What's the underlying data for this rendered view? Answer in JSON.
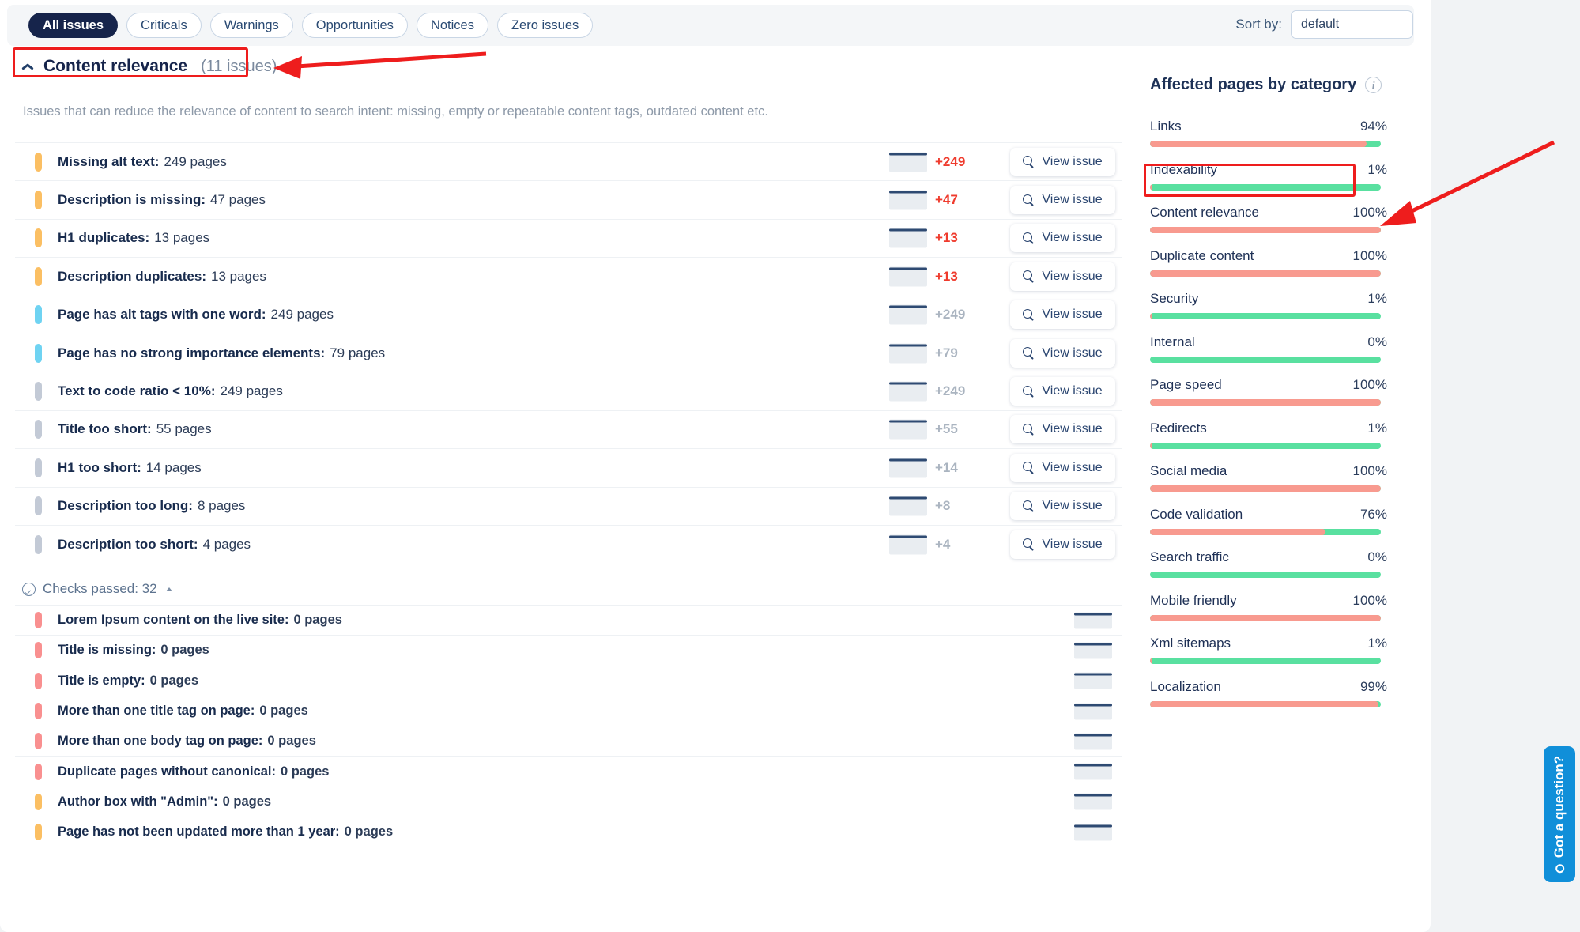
{
  "filters": {
    "items": [
      {
        "label": "All issues",
        "active": true
      },
      {
        "label": "Criticals",
        "active": false
      },
      {
        "label": "Warnings",
        "active": false
      },
      {
        "label": "Opportunities",
        "active": false
      },
      {
        "label": "Notices",
        "active": false
      },
      {
        "label": "Zero issues",
        "active": false
      }
    ]
  },
  "sort": {
    "label": "Sort by:",
    "value": "default",
    "options": [
      "default"
    ]
  },
  "section": {
    "title": "Content relevance",
    "count": "(11 issues)",
    "description": "Issues that can reduce the relevance of content to search intent: missing, empty or repeatable content tags, outdated content etc."
  },
  "issues": [
    {
      "label": "Missing alt text:",
      "count": "249 pages",
      "severity": "warning",
      "delta": "+249",
      "delta_tone": "red",
      "action": "View issue"
    },
    {
      "label": "Description is missing:",
      "count": "47 pages",
      "severity": "warning",
      "delta": "+47",
      "delta_tone": "red",
      "action": "View issue"
    },
    {
      "label": "H1 duplicates:",
      "count": "13 pages",
      "severity": "warning",
      "delta": "+13",
      "delta_tone": "red",
      "action": "View issue"
    },
    {
      "label": "Description duplicates:",
      "count": "13 pages",
      "severity": "warning",
      "delta": "+13",
      "delta_tone": "red",
      "action": "View issue"
    },
    {
      "label": "Page has alt tags with one word:",
      "count": "249 pages",
      "severity": "opportunity",
      "delta": "+249",
      "delta_tone": "gray",
      "action": "View issue"
    },
    {
      "label": "Page has no strong importance elements:",
      "count": "79 pages",
      "severity": "opportunity",
      "delta": "+79",
      "delta_tone": "gray",
      "action": "View issue"
    },
    {
      "label": "Text to code ratio < 10%:",
      "count": "249 pages",
      "severity": "notice",
      "delta": "+249",
      "delta_tone": "gray",
      "action": "View issue"
    },
    {
      "label": "Title too short:",
      "count": "55 pages",
      "severity": "notice",
      "delta": "+55",
      "delta_tone": "gray",
      "action": "View issue"
    },
    {
      "label": "H1 too short:",
      "count": "14 pages",
      "severity": "notice",
      "delta": "+14",
      "delta_tone": "gray",
      "action": "View issue"
    },
    {
      "label": "Description too long:",
      "count": "8 pages",
      "severity": "notice",
      "delta": "+8",
      "delta_tone": "gray",
      "action": "View issue"
    },
    {
      "label": "Description too short:",
      "count": "4 pages",
      "severity": "notice",
      "delta": "+4",
      "delta_tone": "gray",
      "action": "View issue"
    }
  ],
  "checks_passed": {
    "label": "Checks passed: 32",
    "items": [
      {
        "label": "Lorem Ipsum content on the live site:",
        "count": "0 pages",
        "severity": "critical"
      },
      {
        "label": "Title is missing:",
        "count": "0 pages",
        "severity": "critical"
      },
      {
        "label": "Title is empty:",
        "count": "0 pages",
        "severity": "critical"
      },
      {
        "label": "More than one title tag on page:",
        "count": "0 pages",
        "severity": "critical"
      },
      {
        "label": "More than one body tag on page:",
        "count": "0 pages",
        "severity": "critical"
      },
      {
        "label": "Duplicate pages without canonical:",
        "count": "0 pages",
        "severity": "critical"
      },
      {
        "label": "Author box with \"Admin\":",
        "count": "0 pages",
        "severity": "warning"
      },
      {
        "label": "Page has not been updated more than 1 year:",
        "count": "0 pages",
        "severity": "warning"
      }
    ]
  },
  "aside": {
    "title": "Affected pages by category",
    "categories": [
      {
        "name": "Links",
        "percent": "94%",
        "value": 94
      },
      {
        "name": "Indexability",
        "percent": "1%",
        "value": 1
      },
      {
        "name": "Content relevance",
        "percent": "100%",
        "value": 100
      },
      {
        "name": "Duplicate content",
        "percent": "100%",
        "value": 100
      },
      {
        "name": "Security",
        "percent": "1%",
        "value": 1
      },
      {
        "name": "Internal",
        "percent": "0%",
        "value": 0
      },
      {
        "name": "Page speed",
        "percent": "100%",
        "value": 100
      },
      {
        "name": "Redirects",
        "percent": "1%",
        "value": 1
      },
      {
        "name": "Social media",
        "percent": "100%",
        "value": 100
      },
      {
        "name": "Code validation",
        "percent": "76%",
        "value": 76
      },
      {
        "name": "Search traffic",
        "percent": "0%",
        "value": 0
      },
      {
        "name": "Mobile friendly",
        "percent": "100%",
        "value": 100
      },
      {
        "name": "Xml sitemaps",
        "percent": "1%",
        "value": 1
      },
      {
        "name": "Localization",
        "percent": "99%",
        "value": 99
      }
    ]
  },
  "chat": {
    "label": "Got a question?"
  },
  "colors": {
    "severity_critical": "#f99090",
    "severity_warning": "#fbbf63",
    "severity_opportunity": "#6fd3f2",
    "severity_notice": "#c3cad6",
    "bar_affected": "#f89a8f",
    "bar_ok": "#59e0a0",
    "accent_navy": "#16244b",
    "delta_red": "#ef3b2d",
    "annotation": "#ee1d1d",
    "chat_blue": "#108fd9"
  }
}
